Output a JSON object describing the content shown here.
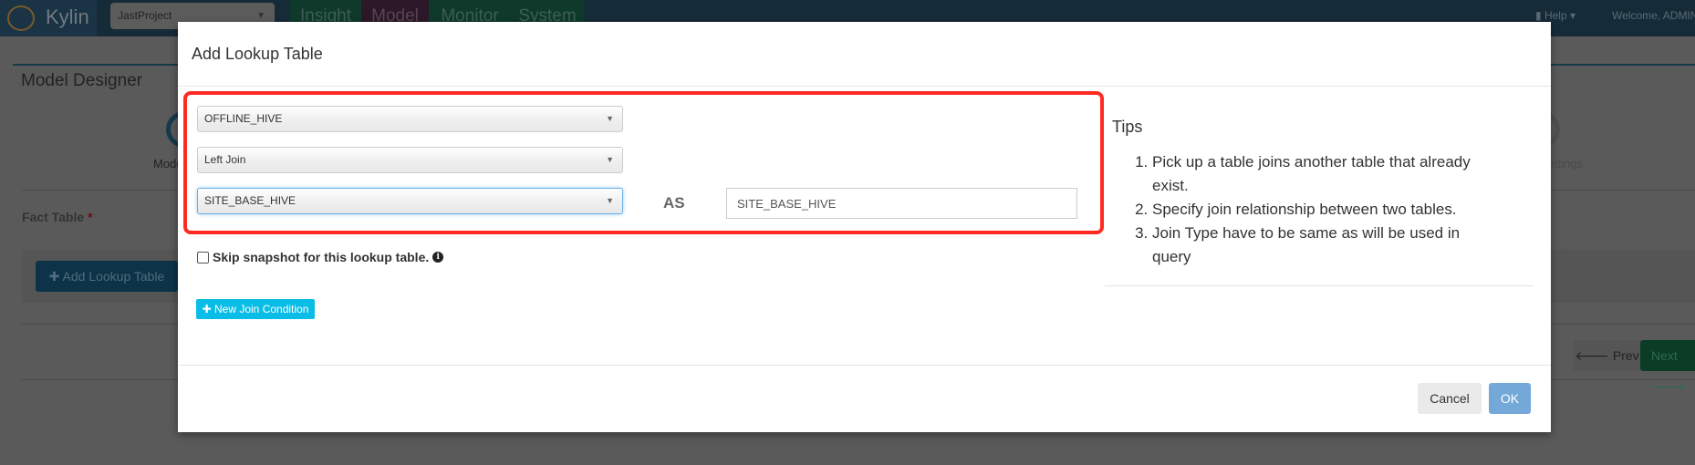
{
  "navbar": {
    "brand": "Kylin",
    "project": "JastProject",
    "tabs": [
      "Insight",
      "Model",
      "Monitor",
      "System"
    ],
    "help": "Help",
    "welcome": "Welcome, ADMIN"
  },
  "background": {
    "page_title": "Model Designer",
    "step_label": "Model Info",
    "step_label_right": "Settings",
    "fact_table_label": "Fact Table",
    "required_mark": "*",
    "add_lookup_button": "Add Lookup Table",
    "prev_button": "Prev",
    "next_button": "Next"
  },
  "modal": {
    "title": "Add Lookup Table",
    "source_table": "OFFLINE_HIVE",
    "join_type": "Left Join",
    "lookup_table": "SITE_BASE_HIVE",
    "as_label": "AS",
    "alias": "SITE_BASE_HIVE",
    "skip_snapshot_label": "Skip snapshot for this lookup table.",
    "skip_snapshot_checked": false,
    "new_join_button": "New Join Condition",
    "tips": {
      "title": "Tips",
      "items": [
        "Pick up a table joins another table that already exist.",
        "Specify join relationship between two tables.",
        "Join Type have to be same as will be used in query"
      ]
    },
    "cancel_button": "Cancel",
    "ok_button": "OK"
  },
  "colors": {
    "highlight_box": "#ff2a22",
    "new_join": "#0abde6",
    "ok": "#73a8d8"
  }
}
